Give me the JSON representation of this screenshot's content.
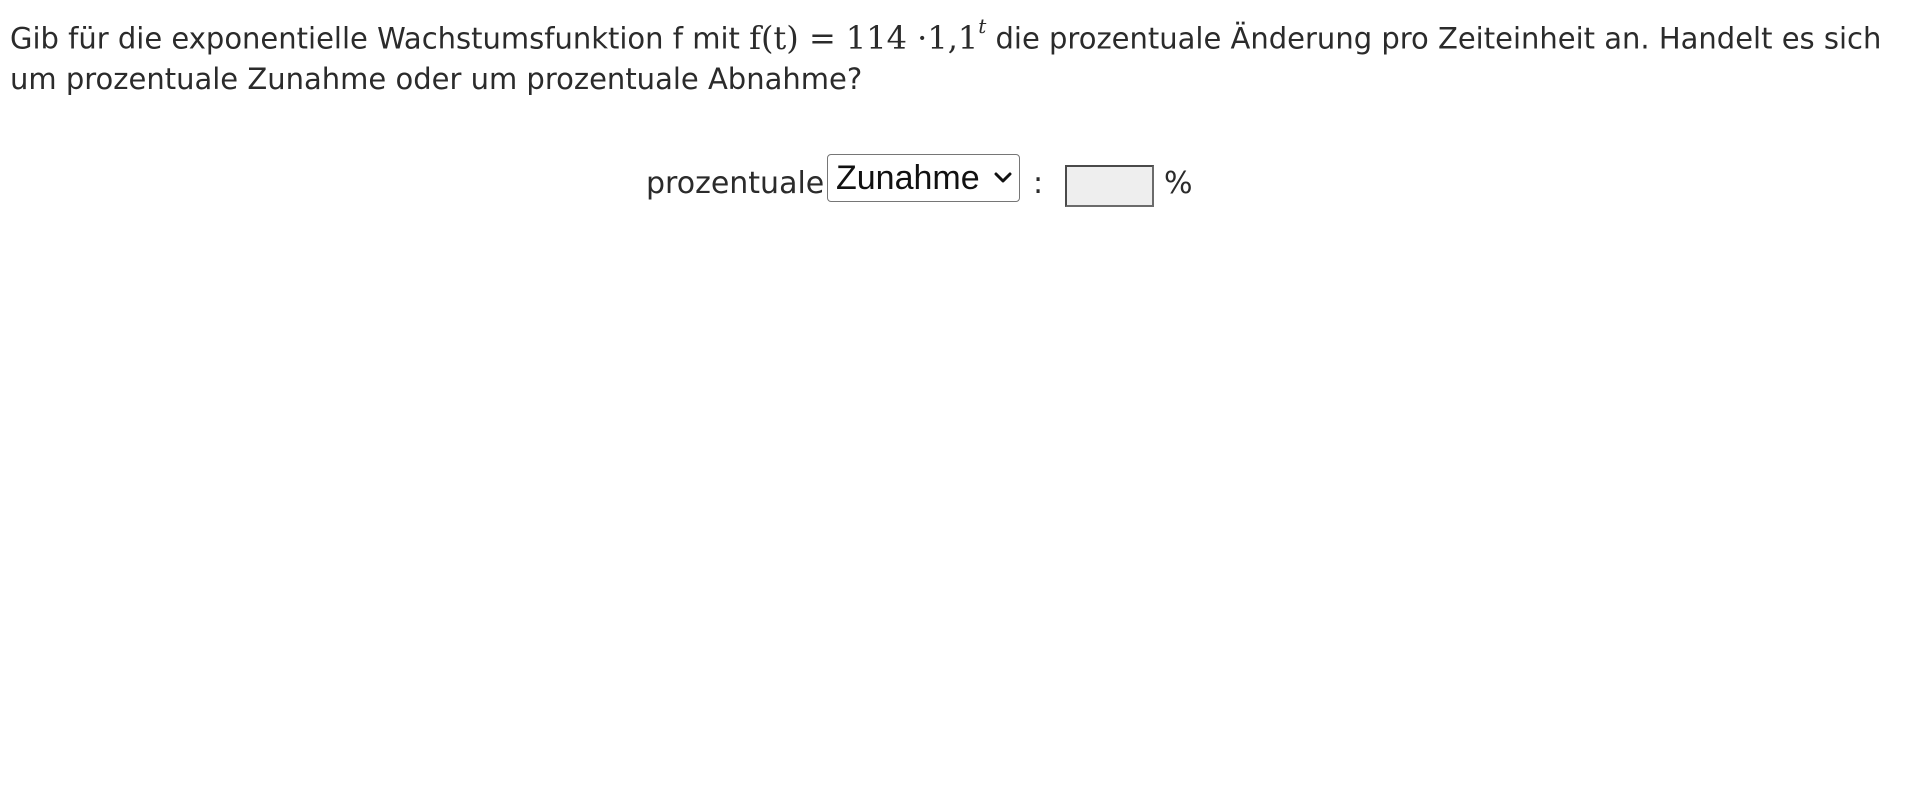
{
  "question": {
    "text_before": "Gib für die exponentielle Wachstumsfunktion f mit ",
    "formula_base": "f(t) = 114 ·1,1",
    "formula_exponent": "t",
    "text_after": " die prozentuale Änderung pro Zeiteinheit an. Handelt es sich um prozentuale Zunahme oder um prozentuale Abnahme?"
  },
  "answer": {
    "prefix_label": "prozentuale",
    "change_select": {
      "selected": "Zunahme",
      "icon": "chevron-down-icon"
    },
    "colon": ":",
    "percent_value": "",
    "percent_sign": "%"
  }
}
